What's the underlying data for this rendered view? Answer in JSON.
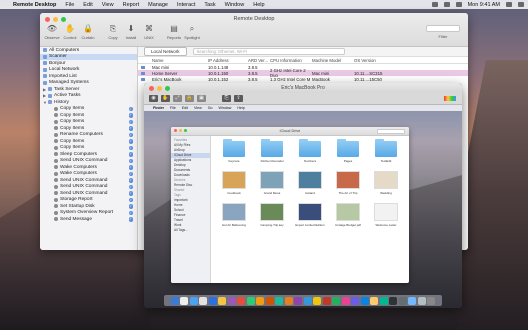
{
  "menubar": {
    "app_name": "Remote Desktop",
    "items": [
      "File",
      "Edit",
      "View",
      "Report",
      "Manage",
      "Interact",
      "Task",
      "Window",
      "Help"
    ],
    "clock": "Mon 9:41 AM"
  },
  "window": {
    "title": "Remote Desktop",
    "toolbar": [
      {
        "label": "Observe",
        "icon": "binoculars-icon",
        "glyph": "👁"
      },
      {
        "label": "Control",
        "icon": "hand-icon",
        "glyph": "✋"
      },
      {
        "label": "Curtain",
        "icon": "lock-icon",
        "glyph": "🔒"
      },
      {
        "label": "Copy",
        "icon": "copy-icon",
        "glyph": "⎘"
      },
      {
        "label": "Install",
        "icon": "install-icon",
        "glyph": "⬇"
      },
      {
        "label": "UNIX",
        "icon": "unix-icon",
        "glyph": "⌘"
      },
      {
        "label": "Reports",
        "icon": "reports-icon",
        "glyph": "▤"
      },
      {
        "label": "Spotlight",
        "icon": "spotlight-icon",
        "glyph": "⌕"
      }
    ],
    "filter_label": "Filter"
  },
  "sidebar": {
    "items": [
      {
        "label": "All Computers",
        "icon": "computers-icon",
        "level": 0,
        "selected": false,
        "check": false
      },
      {
        "label": "Scanner",
        "icon": "scanner-icon",
        "level": 0,
        "selected": true,
        "check": false
      },
      {
        "label": "Bonjour",
        "icon": "bonjour-icon",
        "level": 0,
        "selected": false,
        "check": false
      },
      {
        "label": "Local Network",
        "icon": "network-icon",
        "level": 0,
        "selected": false,
        "check": false
      },
      {
        "label": "Imported List",
        "icon": "list-icon",
        "level": 0,
        "selected": false,
        "check": false
      },
      {
        "label": "Managed Systems",
        "icon": "list-icon",
        "level": 0,
        "selected": false,
        "check": false
      },
      {
        "label": "Task Server",
        "icon": "task-server-icon",
        "level": 0,
        "selected": false,
        "check": false
      },
      {
        "label": "Active Tasks",
        "icon": "task-icon",
        "level": 0,
        "selected": false,
        "check": false
      },
      {
        "label": "History",
        "icon": "history-icon",
        "level": 0,
        "selected": false,
        "check": false
      },
      {
        "label": "Copy Items",
        "icon": "task-icon",
        "level": 1,
        "selected": false,
        "check": true
      },
      {
        "label": "Copy Items",
        "icon": "task-icon",
        "level": 1,
        "selected": false,
        "check": true
      },
      {
        "label": "Copy Items",
        "icon": "task-icon",
        "level": 1,
        "selected": false,
        "check": true
      },
      {
        "label": "Copy Items",
        "icon": "task-icon",
        "level": 1,
        "selected": false,
        "check": true
      },
      {
        "label": "Rename Computers",
        "icon": "task-icon",
        "level": 1,
        "selected": false,
        "check": true
      },
      {
        "label": "Copy Items",
        "icon": "task-icon",
        "level": 1,
        "selected": false,
        "check": true
      },
      {
        "label": "Copy Items",
        "icon": "task-icon",
        "level": 1,
        "selected": false,
        "check": true
      },
      {
        "label": "Sleep Computers",
        "icon": "task-icon",
        "level": 1,
        "selected": false,
        "check": true
      },
      {
        "label": "Send UNIX Command",
        "icon": "task-icon",
        "level": 1,
        "selected": false,
        "check": true
      },
      {
        "label": "Wake Computers",
        "icon": "task-icon",
        "level": 1,
        "selected": false,
        "check": true
      },
      {
        "label": "Wake Computers",
        "icon": "task-icon",
        "level": 1,
        "selected": false,
        "check": true
      },
      {
        "label": "Send UNIX Command",
        "icon": "task-icon",
        "level": 1,
        "selected": false,
        "check": true
      },
      {
        "label": "Send UNIX Command",
        "icon": "task-icon",
        "level": 1,
        "selected": false,
        "check": true
      },
      {
        "label": "Send UNIX Command",
        "icon": "task-icon",
        "level": 1,
        "selected": false,
        "check": true
      },
      {
        "label": "Storage Report",
        "icon": "report-icon",
        "level": 1,
        "selected": false,
        "check": true
      },
      {
        "label": "Set Startup Disk",
        "icon": "task-icon",
        "level": 1,
        "selected": false,
        "check": true
      },
      {
        "label": "System Overview Report",
        "icon": "report-icon",
        "level": 1,
        "selected": false,
        "check": true
      },
      {
        "label": "Send Message",
        "icon": "message-icon",
        "level": 1,
        "selected": false,
        "check": true
      }
    ]
  },
  "main": {
    "scope_button": "Local Network",
    "search_placeholder": "Searching: Ethernet, Wi-Fi",
    "columns": [
      "",
      "Name",
      "IP Address",
      "ARD Ver...",
      "CPU Information",
      "Machine Model",
      "OS Version"
    ],
    "rows": [
      {
        "cells": [
          "",
          "Mac mini",
          "10.0.1.148",
          "3.8.5",
          "",
          "",
          ""
        ],
        "highlight": false
      },
      {
        "cells": [
          "",
          "Home Server",
          "10.0.1.150",
          "3.8.5",
          "2 GHz Intel Core 2 Duo",
          "Mac mini",
          "10.11....SC315"
        ],
        "highlight": true
      },
      {
        "cells": [
          "",
          "Eric's MacBook",
          "10.0.1.152",
          "3.8.5",
          "1.3 GHz Intel Core M",
          "MacBook",
          "10.11....15C50"
        ],
        "highlight": false
      }
    ]
  },
  "screen_share": {
    "title": "Eric's MacBook Pro",
    "remote_menubar": [
      "Finder",
      "File",
      "Edit",
      "View",
      "Go",
      "Window",
      "Help"
    ],
    "finder": {
      "title": "iCloud Drive",
      "sidebar": [
        {
          "label": "Favorites",
          "header": true,
          "selected": false
        },
        {
          "label": "All My Files",
          "header": false,
          "selected": false
        },
        {
          "label": "AirDrop",
          "header": false,
          "selected": false
        },
        {
          "label": "iCloud Drive",
          "header": false,
          "selected": true
        },
        {
          "label": "Applications",
          "header": false,
          "selected": false
        },
        {
          "label": "Desktop",
          "header": false,
          "selected": false
        },
        {
          "label": "Documents",
          "header": false,
          "selected": false
        },
        {
          "label": "Downloads",
          "header": false,
          "selected": false
        },
        {
          "label": "Devices",
          "header": true,
          "selected": false
        },
        {
          "label": "Remote Disc",
          "header": false,
          "selected": false
        },
        {
          "label": "Shared",
          "header": true,
          "selected": false
        },
        {
          "label": "Tags",
          "header": true,
          "selected": false
        },
        {
          "label": "Important",
          "header": false,
          "selected": false
        },
        {
          "label": "Home",
          "header": false,
          "selected": false
        },
        {
          "label": "School",
          "header": false,
          "selected": false
        },
        {
          "label": "Finance",
          "header": false,
          "selected": false
        },
        {
          "label": "Travel",
          "header": false,
          "selected": false
        },
        {
          "label": "Work",
          "header": false,
          "selected": false
        },
        {
          "label": "All Tags...",
          "header": false,
          "selected": false
        }
      ],
      "items": [
        {
          "label": "Keynote",
          "kind": "folder",
          "color": ""
        },
        {
          "label": "Kitchen Remodel",
          "kind": "folder",
          "color": ""
        },
        {
          "label": "Numbers",
          "kind": "folder",
          "color": ""
        },
        {
          "label": "Pages",
          "kind": "folder",
          "color": ""
        },
        {
          "label": "TextEdit",
          "kind": "folder",
          "color": ""
        },
        {
          "label": "Cookbook",
          "kind": "thumb",
          "color": "#d8a457"
        },
        {
          "label": "Grand Mesa",
          "kind": "thumb",
          "color": "#7ea2b8"
        },
        {
          "label": "Iceland",
          "kind": "thumb",
          "color": "#4f7f9e"
        },
        {
          "label": "The Art of Trip",
          "kind": "thumb",
          "color": "#c86a4a"
        },
        {
          "label": "Wedding",
          "kind": "thumb",
          "color": "#e5d9c7"
        },
        {
          "label": "Hot Air Ballooning",
          "kind": "thumb",
          "color": "#8aa5c0"
        },
        {
          "label": "Camping Trip.key",
          "kind": "thumb",
          "color": "#6b8a5a"
        },
        {
          "label": "Expert Limited Edition",
          "kind": "thumb",
          "color": "#3b4d7a"
        },
        {
          "label": "Cottage Budget.pdf",
          "kind": "thumb",
          "color": "#b6c8a4"
        },
        {
          "label": "Welcome Letter",
          "kind": "thumb",
          "color": "#f2f2f2"
        }
      ]
    },
    "dock_colors": [
      "#3b7bd8",
      "#eee",
      "#4aa3f0",
      "#e2e2e2",
      "#2c6fe0",
      "#f5c542",
      "#9b59b6",
      "#e74c3c",
      "#2ecc71",
      "#f39c12",
      "#d35400",
      "#1abc9c",
      "#e67e22",
      "#8e44ad",
      "#3498db",
      "#f1c40f",
      "#c0392b",
      "#27ae60",
      "#e84393",
      "#6c5ce7",
      "#0984e3",
      "#fdcb6e",
      "#00b894",
      "#2d3436",
      "#636e72",
      "#74b9ff",
      "#b2bec3",
      "#888888"
    ]
  }
}
